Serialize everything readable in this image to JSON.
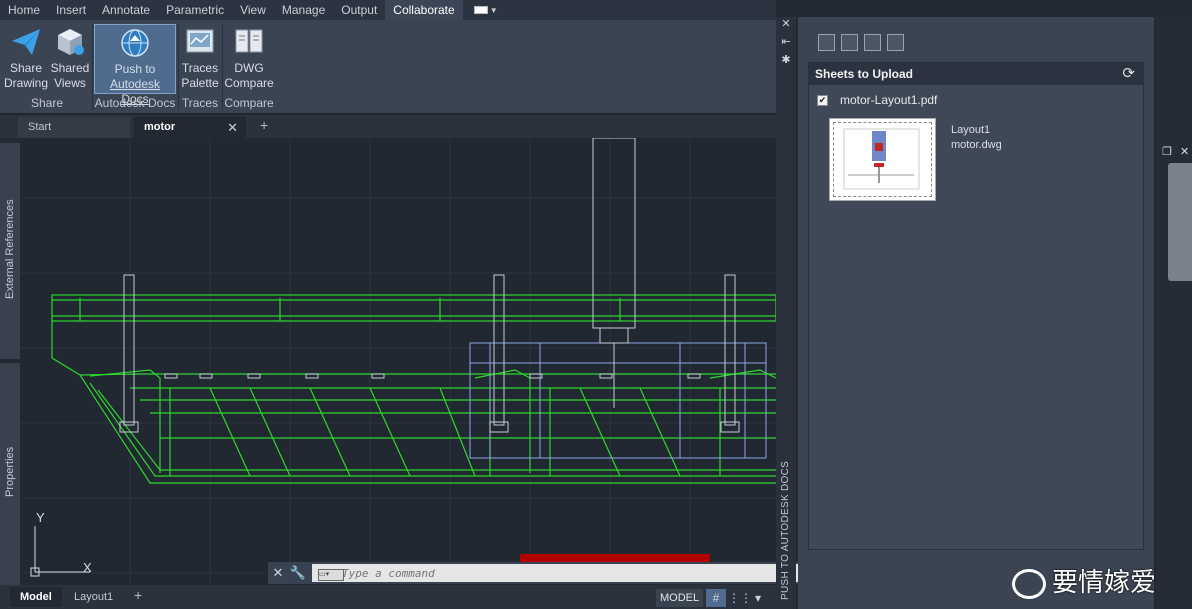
{
  "ribbon": {
    "tabs": [
      "Home",
      "Insert",
      "Annotate",
      "Parametric",
      "View",
      "Manage",
      "Output",
      "Collaborate"
    ],
    "active_tab": "Collaborate",
    "buttons": {
      "share_drawing": [
        "Share",
        "Drawing"
      ],
      "shared_views": [
        "Shared",
        "Views"
      ],
      "push_docs": [
        "Push to",
        "Autodesk Docs"
      ],
      "traces": [
        "Traces",
        "Palette"
      ],
      "dwg_compare": [
        "DWG",
        "Compare"
      ]
    },
    "groups": {
      "share": "Share",
      "autodesk_docs": "Autodesk Docs",
      "traces": "Traces",
      "compare": "Compare"
    }
  },
  "doc_tabs": {
    "start": "Start",
    "active": "motor"
  },
  "side_panels": {
    "external_references": "External References",
    "properties": "Properties"
  },
  "ucs": {
    "x": "X",
    "y": "Y"
  },
  "command": {
    "placeholder": "Type a command"
  },
  "status": {
    "model_tab": "Model",
    "layout_tab": "Layout1",
    "model_button": "MODEL"
  },
  "palette": {
    "title": "PUSH TO AUTODESK DOCS",
    "section_title": "Sheets to Upload",
    "sheet_file": "motor-Layout1.pdf",
    "sheet_checked": true,
    "layout_name": "Layout1",
    "dwg_name": "motor.dwg"
  },
  "watermark": "要情嫁爱",
  "colors": {
    "accent": "#4f6c8e",
    "wire_green": "#2fd62f",
    "wire_blue": "#8ea7e6"
  }
}
